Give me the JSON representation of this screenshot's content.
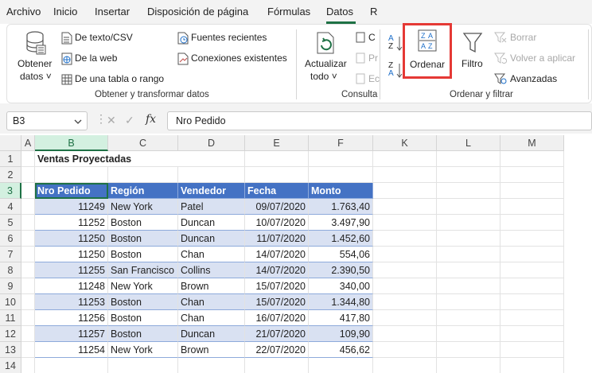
{
  "tabs": [
    "Archivo",
    "Inicio",
    "Insertar",
    "Disposición de página",
    "Fórmulas",
    "Datos",
    "R"
  ],
  "ribbon": {
    "obtener_datos_line1": "Obtener",
    "obtener_datos_line2": "datos ˅",
    "de_texto": "De texto/CSV",
    "de_web": "De la web",
    "de_tabla": "De una tabla o rango",
    "fuentes": "Fuentes recientes",
    "conexiones": "Conexiones existentes",
    "group1": "Obtener y transformar datos",
    "actualizar_line1": "Actualizar",
    "actualizar_line2": "todo ˅",
    "c_letter": "C",
    "p_letter": "Pr",
    "e_letter": "Ec",
    "group2": "Consulta",
    "ordenar": "Ordenar",
    "filtro": "Filtro",
    "borrar": "Borrar",
    "volver": "Volver a aplicar",
    "avanzadas": "Avanzadas",
    "group3": "Ordenar y filtrar",
    "highlight_color": "#e53935",
    "sort_az_top": "A",
    "sort_az_bottom": "Z",
    "sort_za_top": "Z",
    "sort_za_bottom": "A"
  },
  "formula_bar": {
    "namebox": "B3",
    "cancel": "✕",
    "enter": "✓",
    "fx": "fx",
    "value": "Nro Pedido"
  },
  "grid": {
    "columns": [
      "A",
      "B",
      "C",
      "D",
      "E",
      "F",
      "K",
      "L",
      "M"
    ],
    "rows": [
      "1",
      "2",
      "3",
      "4",
      "5",
      "6",
      "7",
      "8",
      "9",
      "10",
      "11",
      "12",
      "13",
      "14"
    ],
    "title": "Ventas Proyectadas",
    "headers": [
      "Nro Pedido",
      "Región",
      "Vendedor",
      "Fecha",
      "Monto"
    ],
    "data": [
      [
        "11249",
        "New York",
        "Patel",
        "09/07/2020",
        "1.763,40"
      ],
      [
        "11252",
        "Boston",
        "Duncan",
        "10/07/2020",
        "3.497,90"
      ],
      [
        "11250",
        "Boston",
        "Duncan",
        "11/07/2020",
        "1.452,60"
      ],
      [
        "11250",
        "Boston",
        "Chan",
        "14/07/2020",
        "554,06"
      ],
      [
        "11255",
        "San Francisco",
        "Collins",
        "14/07/2020",
        "2.390,50"
      ],
      [
        "11248",
        "New York",
        "Brown",
        "15/07/2020",
        "340,00"
      ],
      [
        "11253",
        "Boston",
        "Chan",
        "15/07/2020",
        "1.344,80"
      ],
      [
        "11256",
        "Boston",
        "Chan",
        "16/07/2020",
        "417,80"
      ],
      [
        "11257",
        "Boston",
        "Duncan",
        "21/07/2020",
        "109,90"
      ],
      [
        "11254",
        "New York",
        "Brown",
        "22/07/2020",
        "456,62"
      ]
    ],
    "header_color": "#4472c4",
    "band_color": "#d9e1f2",
    "selection_color": "#1e7145"
  }
}
